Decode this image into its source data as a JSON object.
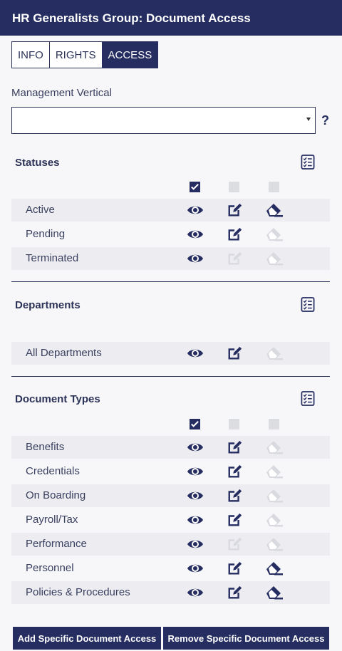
{
  "header": {
    "title": "HR Generalists Group: Document Access"
  },
  "tabs": [
    {
      "label": "INFO",
      "active": false
    },
    {
      "label": "RIGHTS",
      "active": false
    },
    {
      "label": "ACCESS",
      "active": true
    }
  ],
  "management_vertical": {
    "label": "Management Vertical",
    "value": "",
    "help": "?"
  },
  "statuses": {
    "title": "Statuses",
    "header_checks": [
      true,
      false,
      false
    ],
    "rows": [
      {
        "label": "Active",
        "view": true,
        "edit": true,
        "delete": true
      },
      {
        "label": "Pending",
        "view": true,
        "edit": true,
        "delete": false
      },
      {
        "label": "Terminated",
        "view": true,
        "edit": false,
        "delete": false
      }
    ]
  },
  "departments": {
    "title": "Departments",
    "rows": [
      {
        "label": "All Departments",
        "view": true,
        "edit": true,
        "delete": false
      }
    ]
  },
  "document_types": {
    "title": "Document Types",
    "header_checks": [
      true,
      false,
      false
    ],
    "rows": [
      {
        "label": "Benefits",
        "view": true,
        "edit": true,
        "delete": false
      },
      {
        "label": "Credentials",
        "view": true,
        "edit": true,
        "delete": false
      },
      {
        "label": "On Boarding",
        "view": true,
        "edit": true,
        "delete": false
      },
      {
        "label": "Payroll/Tax",
        "view": true,
        "edit": true,
        "delete": false
      },
      {
        "label": "Performance",
        "view": true,
        "edit": false,
        "delete": false
      },
      {
        "label": "Personnel",
        "view": true,
        "edit": true,
        "delete": true
      },
      {
        "label": "Policies & Procedures",
        "view": true,
        "edit": true,
        "delete": true
      }
    ]
  },
  "buttons": {
    "add": "Add Specific Document Access",
    "remove": "Remove Specific Document Access"
  },
  "colors": {
    "primary": "#252d61",
    "disabled": "#d9dadf",
    "row_shade": "#ededf1"
  }
}
